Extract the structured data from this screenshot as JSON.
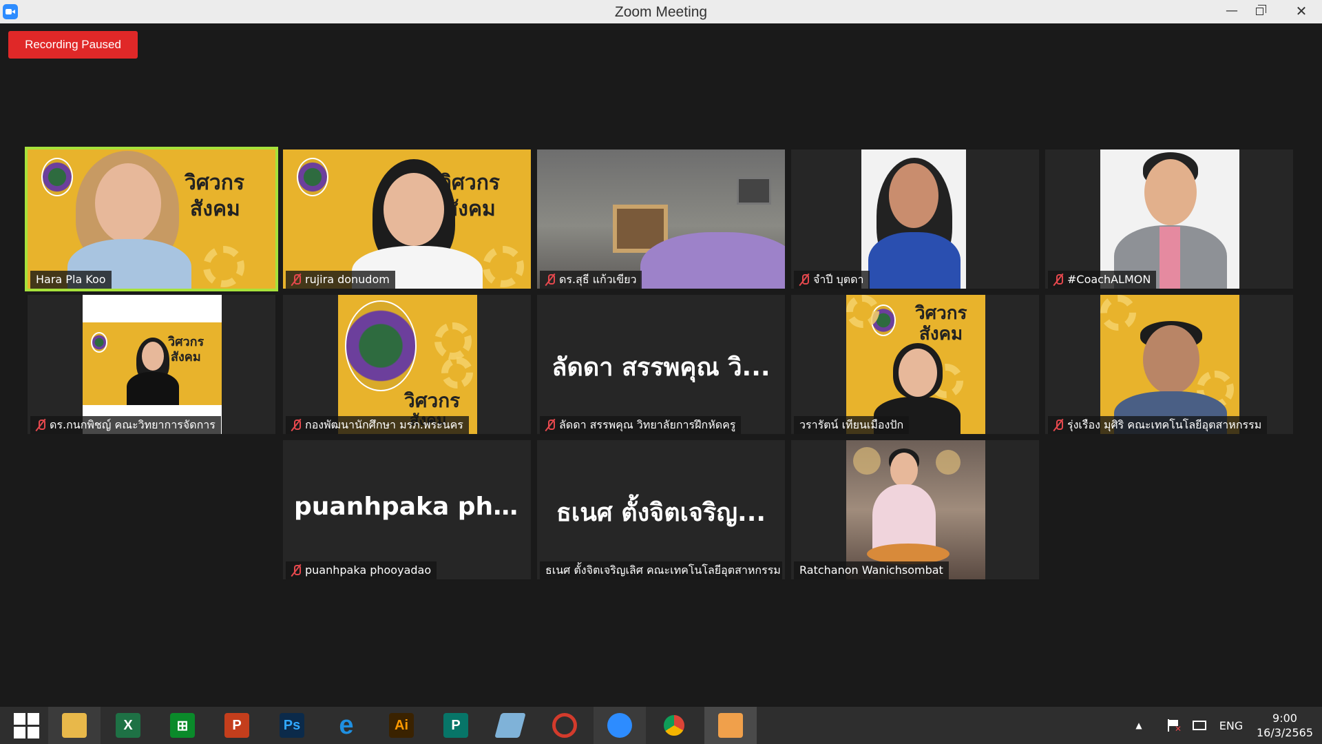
{
  "window": {
    "title": "Zoom Meeting",
    "minimize": "—",
    "close": "✕"
  },
  "recording": {
    "label": "Recording Paused",
    "color": "#e02828"
  },
  "participants": [
    {
      "name": "Hara Pla Koo",
      "muted": false,
      "active": true,
      "video": "photo"
    },
    {
      "name": "rujira donudom",
      "muted": true,
      "video": "photo"
    },
    {
      "name": "ดร.สุธี แก้วเขียว",
      "muted": true,
      "video": "photo"
    },
    {
      "name": "จำปี บุตดา",
      "muted": true,
      "video": "photo"
    },
    {
      "name": "#CoachALMON",
      "muted": true,
      "video": "photo"
    },
    {
      "name": "ดร.กนกพิชญ์ คณะวิทยาการจัดการ",
      "muted": true,
      "video": "photo"
    },
    {
      "name": "กองพัฒนานักศึกษา มรภ.พระนคร",
      "muted": true,
      "video": "photo"
    },
    {
      "name": "ลัดดา สรรพคุณ วิทยาลัยการฝึกหัดครู",
      "muted": true,
      "video": "off",
      "display": "ลัดดา สรรพคุณ วิ..."
    },
    {
      "name": "วรารัตน์ เทียนเมืองปัก",
      "muted": false,
      "video": "photo"
    },
    {
      "name": "รุ่งเรือง มุศิริ คณะเทคโนโลยีอุตสาหกรรม",
      "muted": true,
      "video": "photo"
    },
    {
      "name": "puanhpaka phooyadao",
      "muted": true,
      "video": "off",
      "display": "puanhpaka pho..."
    },
    {
      "name": "ธเนศ ตั้งจิตเจริญเลิศ คณะเทคโนโลยีอุตสาหกรรม",
      "muted": false,
      "video": "off",
      "display": "ธเนศ ตั้งจิตเจริญ..."
    },
    {
      "name": "Ratchanon Wanichsombat",
      "muted": false,
      "video": "photo"
    }
  ],
  "background_brand": {
    "line1": "วิศวกร",
    "line2": "สังคม"
  },
  "taskbar": {
    "apps": [
      {
        "name": "start",
        "icon": "windows-logo"
      },
      {
        "name": "file-explorer",
        "icon": "folder-icon",
        "color": "#e8b84a"
      },
      {
        "name": "excel",
        "icon": "excel-icon",
        "label": "X",
        "color": "#1e7145"
      },
      {
        "name": "store",
        "icon": "store-icon",
        "label": "⊞",
        "color": "#0a8a2a"
      },
      {
        "name": "powerpoint",
        "icon": "powerpoint-icon",
        "label": "P",
        "color": "#c43e1c"
      },
      {
        "name": "photoshop",
        "icon": "photoshop-icon",
        "label": "Ps",
        "color": "#0b2a4a"
      },
      {
        "name": "internet-explorer",
        "icon": "ie-icon",
        "label": "e",
        "color": "#1f8fe0"
      },
      {
        "name": "illustrator",
        "icon": "illustrator-icon",
        "label": "Ai",
        "color": "#3a2200"
      },
      {
        "name": "publisher",
        "icon": "publisher-icon",
        "label": "P",
        "color": "#077568"
      },
      {
        "name": "notepad",
        "icon": "notepad-icon",
        "label": "",
        "color": "#7fb2d8"
      },
      {
        "name": "photoscape",
        "icon": "photoscape-icon",
        "label": "",
        "color": "#d33b2c"
      },
      {
        "name": "zoom",
        "icon": "zoom-icon",
        "label": "",
        "color": "#2d8cff"
      },
      {
        "name": "chrome",
        "icon": "chrome-icon",
        "label": "",
        "color": "#db4437"
      },
      {
        "name": "paint",
        "icon": "paint-icon",
        "label": "",
        "color": "#f0a04b"
      }
    ],
    "tray_up": "▲",
    "language": "ENG",
    "time": "9:00",
    "date": "16/3/2565"
  }
}
